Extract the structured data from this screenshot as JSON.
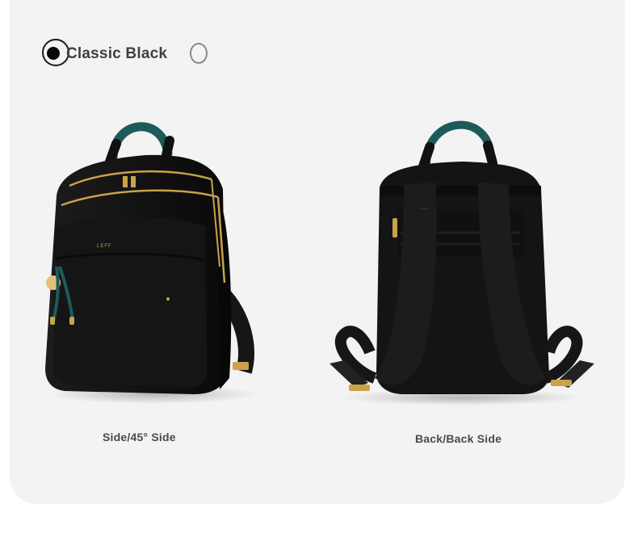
{
  "swatch": {
    "selected_label": "Classic Black",
    "selected_color": "#0a0a0a"
  },
  "views": [
    {
      "caption": "Side/45° Side"
    },
    {
      "caption": "Back/Back Side"
    }
  ],
  "brand_mark": "LEFF",
  "colors": {
    "panel": "#f3f3f3",
    "bag": "#141414",
    "handle_accent": "#1f5a5a",
    "zipper_gold": "#c9a24a"
  }
}
